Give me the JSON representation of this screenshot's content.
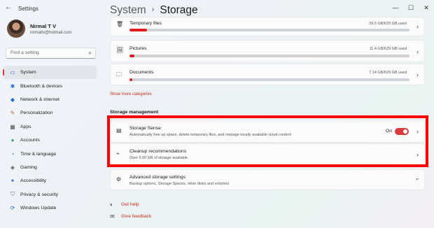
{
  "window": {
    "app_title": "Settings",
    "controls": {
      "minimize": "—",
      "maximize": "☐",
      "close": "✕"
    }
  },
  "profile": {
    "name": "Nirmal T V",
    "email": "nirmaltv@hotmail.com"
  },
  "search": {
    "placeholder": "Find a setting"
  },
  "sidebar": {
    "active_color": "#d83b3b",
    "items": [
      {
        "label": "System",
        "icon": "monitor-icon",
        "active": true
      },
      {
        "label": "Bluetooth & devices",
        "icon": "bluetooth-icon"
      },
      {
        "label": "Network & internet",
        "icon": "wifi-icon"
      },
      {
        "label": "Personalization",
        "icon": "brush-icon"
      },
      {
        "label": "Apps",
        "icon": "apps-icon"
      },
      {
        "label": "Accounts",
        "icon": "person-icon"
      },
      {
        "label": "Time & language",
        "icon": "globe-clock-icon"
      },
      {
        "label": "Gaming",
        "icon": "gamepad-icon"
      },
      {
        "label": "Accessibility",
        "icon": "accessibility-icon"
      },
      {
        "label": "Privacy & security",
        "icon": "shield-icon"
      },
      {
        "label": "Windows Update",
        "icon": "update-icon"
      }
    ]
  },
  "breadcrumb": {
    "parent": "System",
    "separator": "›",
    "current": "Storage"
  },
  "categories": [
    {
      "label": "Temporary files",
      "size": "39.5 GB/629 GB used",
      "fraction": 0.063,
      "icon": "trash-icon"
    },
    {
      "label": "Pictures",
      "size": "11.4 GB/629 GB used",
      "fraction": 0.018,
      "icon": "picture-icon"
    },
    {
      "label": "Documents",
      "size": "7.14 GB/629 GB used",
      "fraction": 0.011,
      "icon": "folder-icon"
    }
  ],
  "show_more": "Show more categories",
  "storage_management": {
    "title": "Storage management",
    "storage_sense": {
      "title": "Storage Sense",
      "subtitle": "Automatically free up space, delete temporary files, and manage locally available cloud content",
      "toggle_label": "On",
      "on": true
    },
    "cleanup": {
      "title": "Cleanup recommendations",
      "subtitle": "Over 5.00 GB of storage available."
    },
    "advanced": {
      "title": "Advanced storage settings",
      "subtitle": "Backup options, Storage Spaces, other disks and volumes"
    }
  },
  "help": {
    "get_help": "Get help",
    "give_feedback": "Give feedback"
  },
  "accent_colors": {
    "bar": "#e01c1c",
    "link": "#c42b1c",
    "highlight": "#ff0000"
  }
}
